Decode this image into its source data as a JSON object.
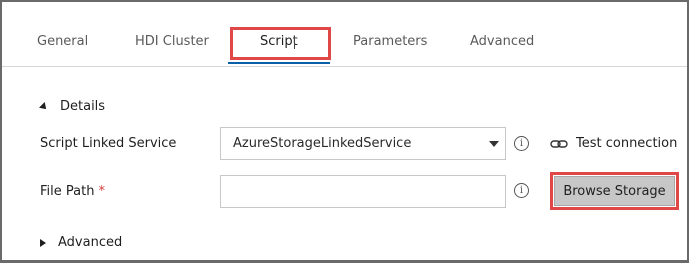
{
  "tabs": [
    {
      "label": "General"
    },
    {
      "label": "HDI Cluster"
    },
    {
      "label": "Script"
    },
    {
      "label": "Parameters"
    },
    {
      "label": "Advanced"
    }
  ],
  "active_tab": "Script",
  "details": {
    "label": "Details",
    "expanded": true,
    "script_linked_service": {
      "label": "Script Linked Service",
      "value": "AzureStorageLinkedService"
    },
    "file_path": {
      "label": "File Path",
      "required_marker": "*",
      "value": ""
    },
    "test_connection_label": "Test connection",
    "browse_storage_label": "Browse Storage"
  },
  "advanced": {
    "label": "Advanced",
    "expanded": false
  },
  "colors": {
    "highlight": "#e04848",
    "accent": "#0a5fa8",
    "required": "#d23c3c"
  },
  "icons": {
    "info": "info-icon",
    "link": "link-icon"
  }
}
